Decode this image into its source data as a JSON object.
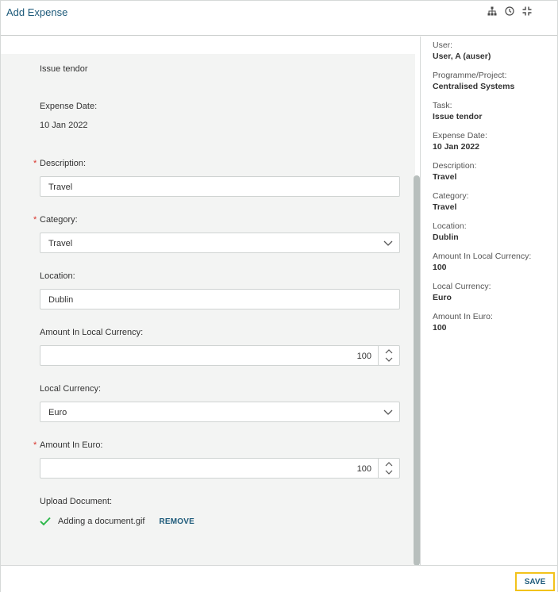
{
  "window": {
    "title": "Add Expense",
    "icons": [
      "hierarchy-icon",
      "history-icon",
      "collapse-icon"
    ]
  },
  "form": {
    "task_value": "Issue tendor",
    "expense_date": {
      "label": "Expense Date:",
      "value": "10 Jan 2022"
    },
    "description": {
      "label": "Description:",
      "value": "Travel",
      "required_marker": "*"
    },
    "category": {
      "label": "Category:",
      "value": "Travel",
      "required_marker": "*"
    },
    "location": {
      "label": "Location:",
      "value": "Dublin"
    },
    "amount_local": {
      "label": "Amount In Local Currency:",
      "value": "100"
    },
    "local_currency": {
      "label": "Local Currency:",
      "value": "Euro"
    },
    "amount_euro": {
      "label": "Amount In Euro:",
      "value": "100",
      "required_marker": "*"
    },
    "upload": {
      "label": "Upload Document:",
      "file_name": "Adding a document.gif",
      "remove_label": "REMOVE"
    }
  },
  "summary": [
    {
      "label": "User:",
      "value": "User, A (auser)"
    },
    {
      "label": "Programme/Project:",
      "value": "Centralised Systems"
    },
    {
      "label": "Task:",
      "value": "Issue tendor"
    },
    {
      "label": "Expense Date:",
      "value": "10 Jan 2022"
    },
    {
      "label": "Description:",
      "value": "Travel"
    },
    {
      "label": "Category:",
      "value": "Travel"
    },
    {
      "label": "Location:",
      "value": "Dublin"
    },
    {
      "label": "Amount In Local Currency:",
      "value": "100"
    },
    {
      "label": "Local Currency:",
      "value": "Euro"
    },
    {
      "label": "Amount In Euro:",
      "value": "100"
    }
  ],
  "footer": {
    "save_label": "SAVE"
  },
  "colors": {
    "accent": "#1d5a7a",
    "required": "#d9342b",
    "success": "#2eb84b",
    "highlight": "#f2c21b"
  }
}
